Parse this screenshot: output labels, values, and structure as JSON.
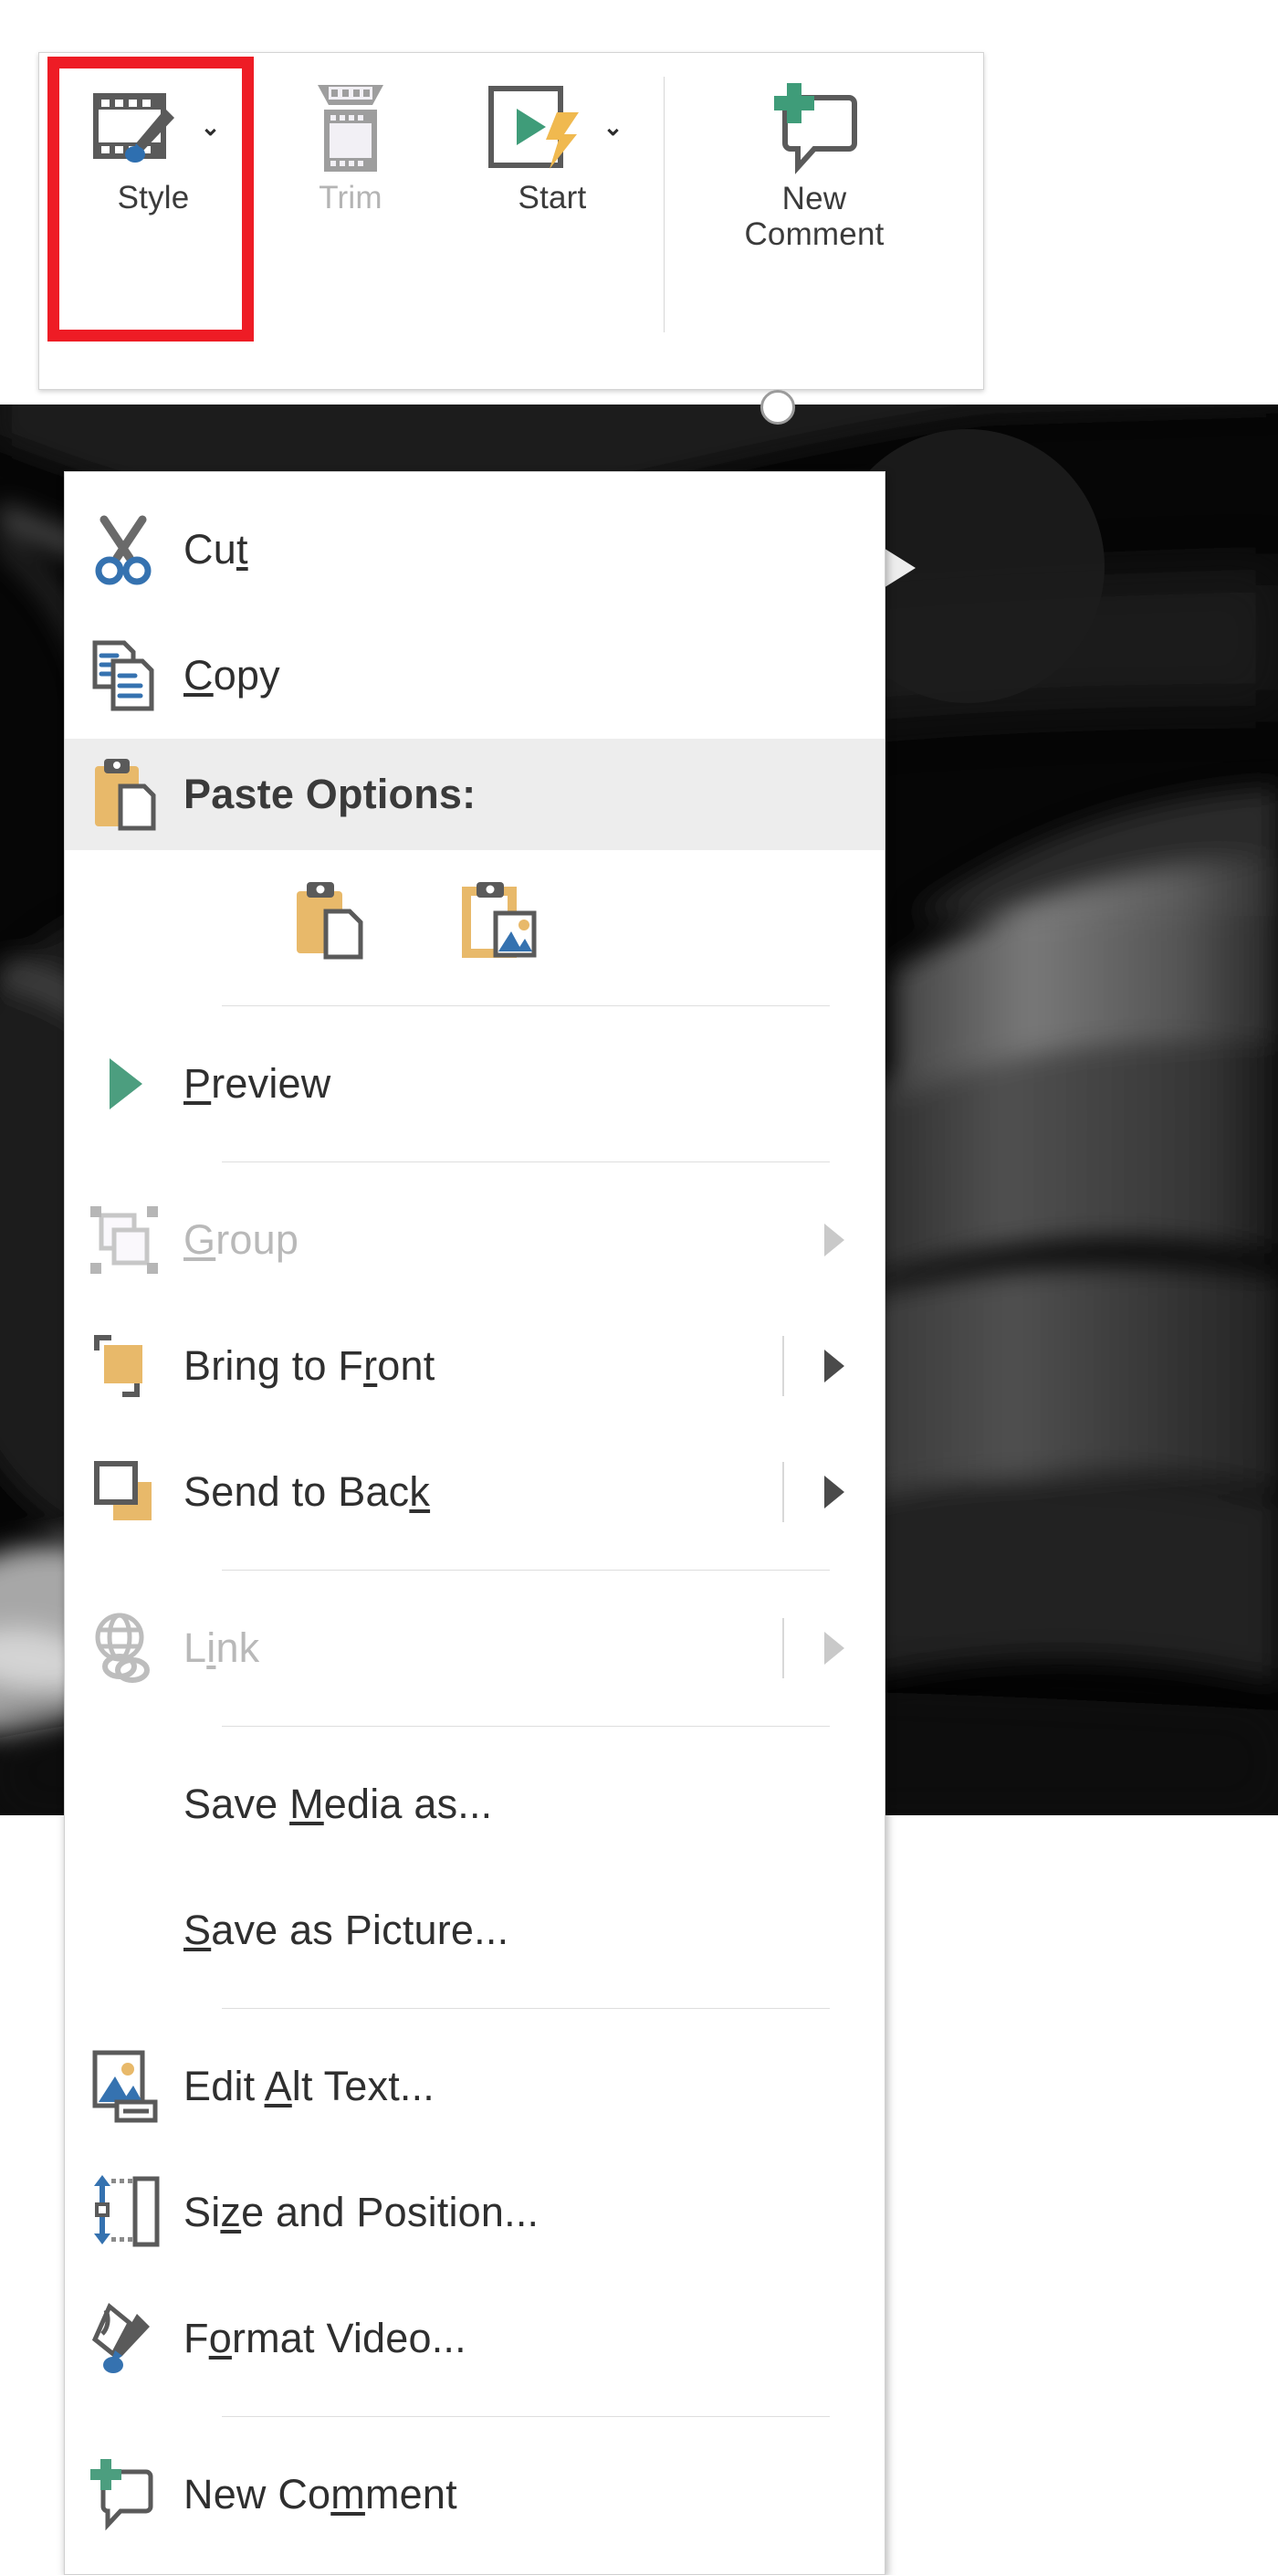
{
  "ribbon": {
    "buttons": [
      {
        "id": "style",
        "label": "Style",
        "icon": "video-style-icon",
        "has_dropdown": true,
        "disabled": false,
        "highlighted": true
      },
      {
        "id": "trim",
        "label": "Trim",
        "icon": "trim-video-icon",
        "has_dropdown": false,
        "disabled": true,
        "highlighted": false
      },
      {
        "id": "start",
        "label": "Start",
        "icon": "video-start-icon",
        "has_dropdown": true,
        "disabled": false,
        "highlighted": false
      },
      {
        "id": "new-comment",
        "label": "New\nComment",
        "label_line1": "New",
        "label_line2": "Comment",
        "icon": "new-comment-icon",
        "has_dropdown": false,
        "disabled": false,
        "highlighted": false
      }
    ],
    "dropdown_glyph": "⌄",
    "highlight_color": "#ee1c25"
  },
  "context_menu": {
    "items": [
      {
        "label": "Cut",
        "accel": "t",
        "icon": "scissors-icon",
        "disabled": false,
        "submenu": false,
        "type": "item"
      },
      {
        "label": "Copy",
        "accel": "C",
        "icon": "copy-documents-icon",
        "disabled": false,
        "submenu": false,
        "type": "item"
      },
      {
        "label": "Paste Options:",
        "accel": "",
        "icon": "clipboard-paste-icon",
        "disabled": false,
        "submenu": false,
        "type": "header"
      },
      {
        "label": "",
        "accel": "",
        "icon": "",
        "disabled": false,
        "submenu": false,
        "type": "paste-options"
      },
      {
        "label": "",
        "accel": "",
        "icon": "",
        "disabled": false,
        "submenu": false,
        "type": "separator"
      },
      {
        "label": "Preview",
        "accel": "P",
        "icon": "play-triangle-icon",
        "disabled": false,
        "submenu": false,
        "type": "item"
      },
      {
        "label": "",
        "accel": "",
        "icon": "",
        "disabled": false,
        "submenu": false,
        "type": "separator"
      },
      {
        "label": "Group",
        "accel": "G",
        "icon": "group-shapes-icon",
        "disabled": true,
        "submenu": true,
        "type": "item"
      },
      {
        "label": "Bring to Front",
        "accel": "r",
        "icon": "bring-to-front-icon",
        "disabled": false,
        "submenu": true,
        "type": "item"
      },
      {
        "label": "Send to Back",
        "accel": "k",
        "icon": "send-to-back-icon",
        "disabled": false,
        "submenu": true,
        "type": "item"
      },
      {
        "label": "Link",
        "accel": "i",
        "icon": "link-globe-icon",
        "disabled": true,
        "submenu": true,
        "type": "item"
      },
      {
        "label": "",
        "accel": "",
        "icon": "",
        "disabled": false,
        "submenu": false,
        "type": "separator"
      },
      {
        "label": "Save Media as...",
        "accel": "M",
        "icon": "",
        "disabled": false,
        "submenu": false,
        "type": "item"
      },
      {
        "label": "Save as Picture...",
        "accel": "S",
        "icon": "",
        "disabled": false,
        "submenu": false,
        "type": "item"
      },
      {
        "label": "",
        "accel": "",
        "icon": "",
        "disabled": false,
        "submenu": false,
        "type": "separator"
      },
      {
        "label": "Edit Alt Text...",
        "accel": "A",
        "icon": "alt-text-image-icon",
        "disabled": false,
        "submenu": false,
        "type": "item"
      },
      {
        "label": "Size and Position...",
        "accel": "z",
        "icon": "size-position-icon",
        "disabled": false,
        "submenu": false,
        "type": "item"
      },
      {
        "label": "Format Video...",
        "accel": "o",
        "icon": "format-video-paint-icon",
        "disabled": false,
        "submenu": false,
        "type": "item"
      },
      {
        "label": "",
        "accel": "",
        "icon": "",
        "disabled": false,
        "submenu": false,
        "type": "separator"
      },
      {
        "label": "New Comment",
        "accel": "m",
        "icon": "new-comment-bubble-icon",
        "disabled": false,
        "submenu": false,
        "type": "item"
      }
    ],
    "paste_options": [
      {
        "name": "keep-source-formatting",
        "icon": "clipboard-document-icon"
      },
      {
        "name": "picture",
        "icon": "clipboard-picture-icon"
      }
    ]
  },
  "media": {
    "kind": "video-placeholder",
    "description": "grayscale ultrasound / CT style medical frame",
    "play_button_visible": true,
    "rotation_handle_visible": true
  },
  "colors": {
    "accent_red": "#ee1c25",
    "clipboard_tan": "#e8b96a",
    "green_play": "#4c9e7f",
    "blue_icon": "#3572b0",
    "gray_icon": "#595959",
    "menu_bg": "#ffffff",
    "header_bg": "#ededed"
  }
}
